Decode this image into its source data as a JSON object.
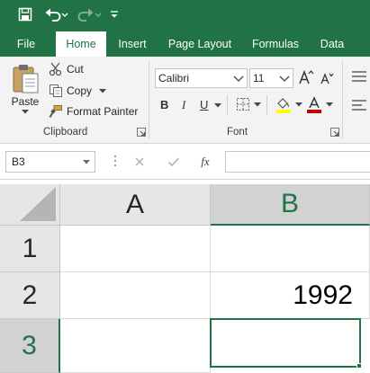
{
  "qat": {
    "save": "save-icon",
    "undo": "undo-icon",
    "redo": "redo-icon",
    "customize": "customize-qat-icon"
  },
  "tabs": [
    "File",
    "Home",
    "Insert",
    "Page Layout",
    "Formulas",
    "Data"
  ],
  "active_tab": "Home",
  "clipboard": {
    "paste_label": "Paste",
    "cut_label": "Cut",
    "copy_label": "Copy",
    "format_painter_label": "Format Painter",
    "group_label": "Clipboard"
  },
  "font": {
    "family": "Calibri",
    "size": "11",
    "bold": "B",
    "italic": "I",
    "underline": "U",
    "function_symbol": "fx",
    "group_label": "Font",
    "font_color": "#c00000",
    "highlight_color": "#ffff00"
  },
  "formula_bar": {
    "name_box": "B3",
    "formula_value": ""
  },
  "grid": {
    "columns": [
      "A",
      "B"
    ],
    "rows": [
      "1",
      "2",
      "3"
    ],
    "selected_column": "B",
    "selected_row": "3",
    "cells": {
      "A1": "",
      "B1": "",
      "A2": "",
      "B2": "1992",
      "A3": "",
      "B3": ""
    }
  },
  "colors": {
    "accent": "#217346",
    "ribbon_bg": "#f3f3f3",
    "header_bg": "#e6e6e6"
  }
}
